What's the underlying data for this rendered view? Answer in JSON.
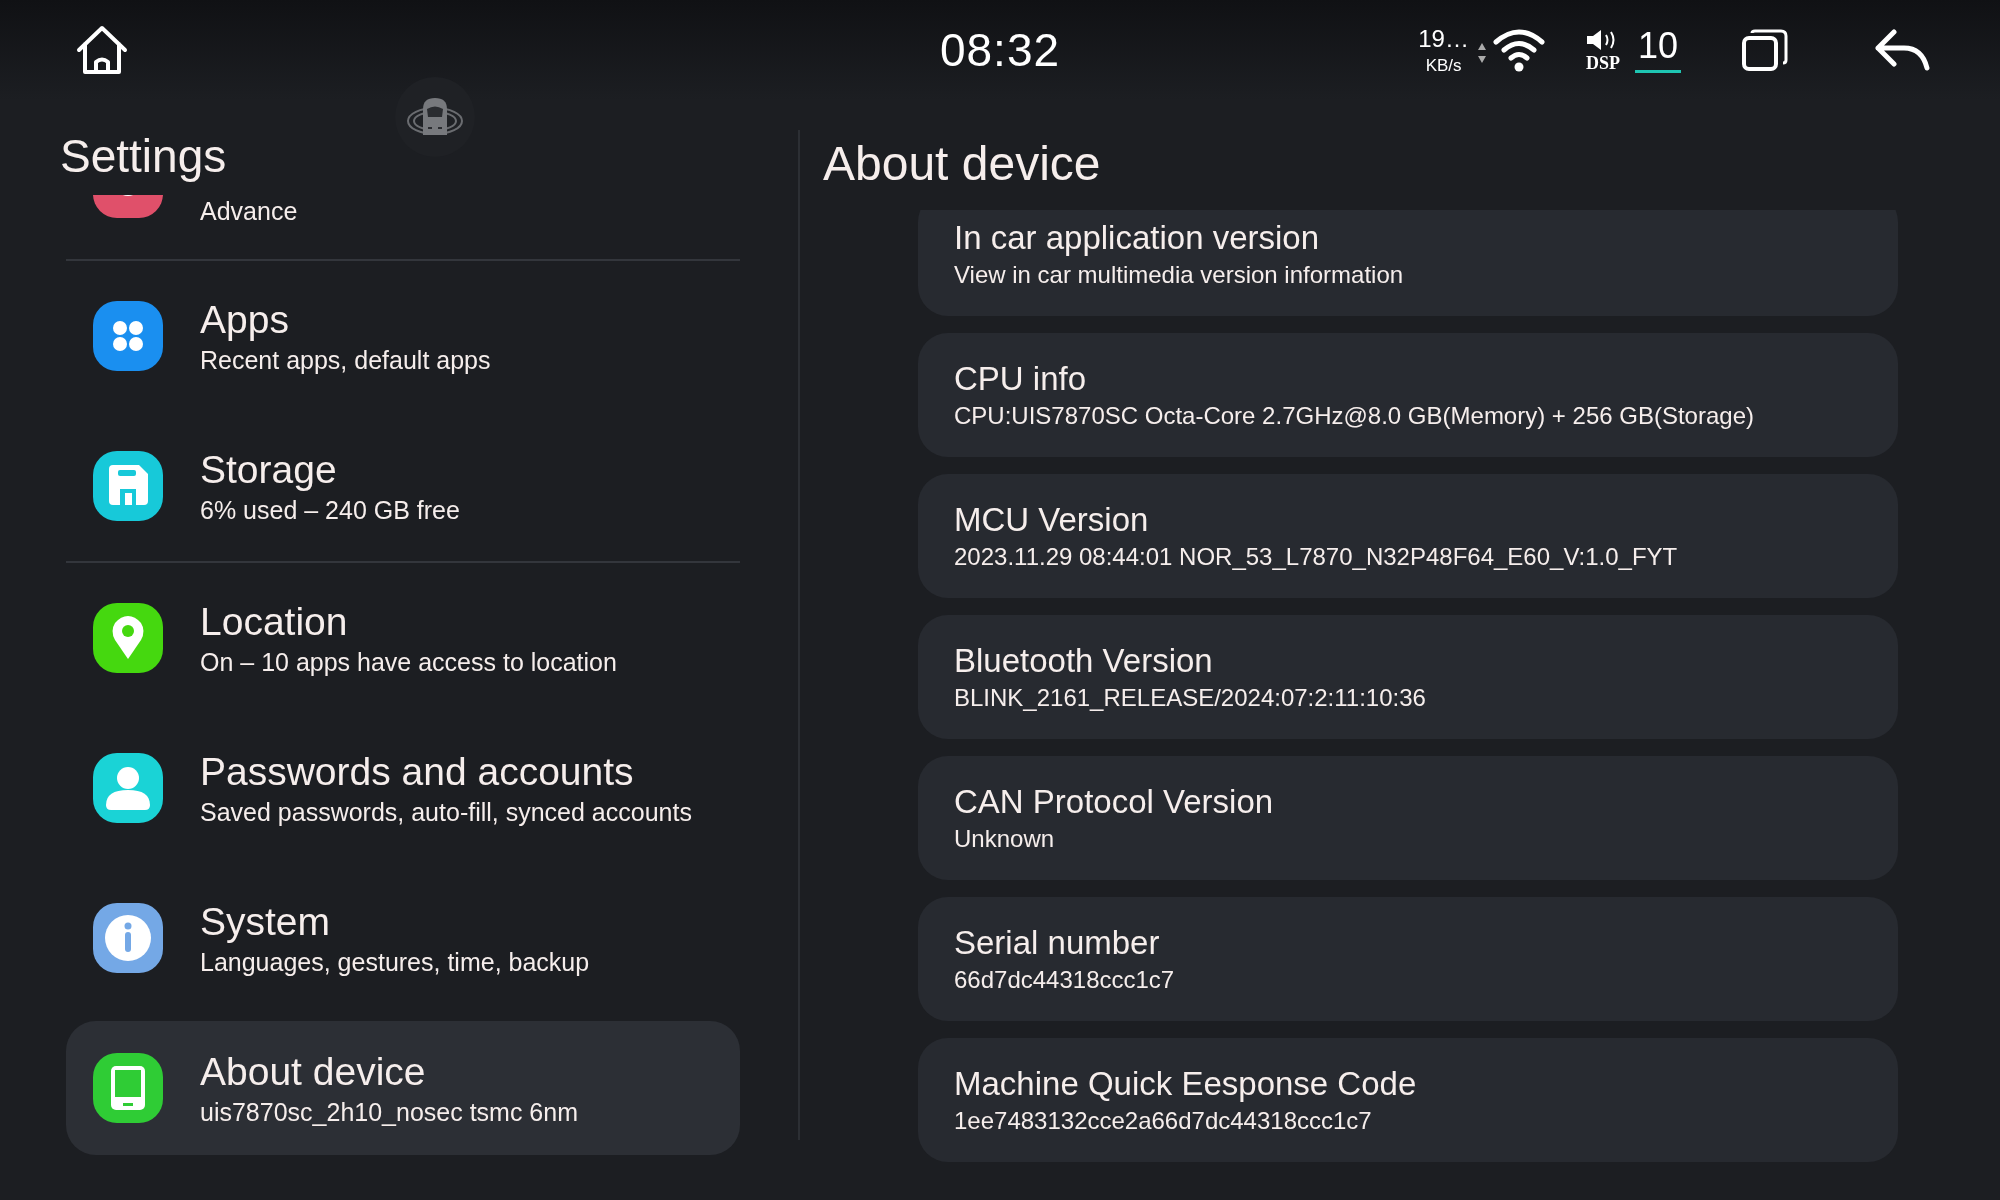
{
  "status_bar": {
    "clock": "08:32",
    "net_speed": "19…",
    "net_unit": "KB/s",
    "volume_label": "DSP",
    "volume": "10"
  },
  "sidebar": {
    "title": "Settings",
    "items": [
      {
        "kind": "advanced",
        "color": "#e0506a",
        "subtitle": "Advance",
        "selected": false,
        "group_end": true
      },
      {
        "kind": "apps",
        "color": "#1a8ff0",
        "title": "Apps",
        "subtitle": "Recent apps, default apps",
        "selected": false,
        "group_end": false
      },
      {
        "kind": "storage",
        "color": "#17c9d9",
        "title": "Storage",
        "subtitle": "6% used – 240 GB free",
        "selected": false,
        "group_end": true
      },
      {
        "kind": "location",
        "color": "#45d80f",
        "title": "Location",
        "subtitle": "On – 10 apps have access to location",
        "selected": false,
        "group_end": false
      },
      {
        "kind": "accounts",
        "color": "#1ad3d6",
        "title": "Passwords and accounts",
        "subtitle": "Saved passwords, auto-fill, synced accounts",
        "selected": false,
        "group_end": false
      },
      {
        "kind": "system",
        "color": "#74a8e6",
        "title": "System",
        "subtitle": "Languages, gestures, time, backup",
        "selected": false,
        "group_end": false
      },
      {
        "kind": "device",
        "color": "#2fcc35",
        "title": "About device",
        "subtitle": "uis7870sc_2h10_nosec tsmc 6nm",
        "selected": true,
        "group_end": false
      }
    ]
  },
  "detail": {
    "title": "About device",
    "items": [
      {
        "title": "In car application version",
        "value": "View in car multimedia version information"
      },
      {
        "title": "CPU info",
        "value": "CPU:UIS7870SC Octa-Core 2.7GHz@8.0 GB(Memory) + 256 GB(Storage)"
      },
      {
        "title": "MCU Version",
        "value": "2023.11.29 08:44:01 NOR_53_L7870_N32P48F64_E60_V:1.0_FYT"
      },
      {
        "title": "Bluetooth Version",
        "value": "BLINK_2161_RELEASE/2024:07:2:11:10:36"
      },
      {
        "title": "CAN Protocol Version",
        "value": "Unknown"
      },
      {
        "title": "Serial number",
        "value": "66d7dc44318ccc1c7"
      },
      {
        "title": "Machine Quick Eesponse Code",
        "value": "1ee7483132cce2a66d7dc44318ccc1c7"
      }
    ]
  }
}
